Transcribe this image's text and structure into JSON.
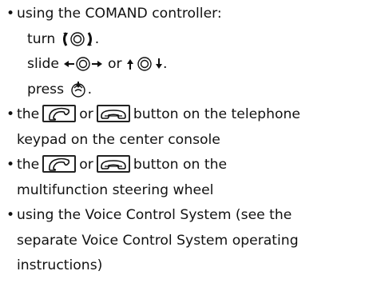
{
  "items": [
    {
      "intro": "using the COMAND controller:",
      "sub": [
        {
          "before": "turn",
          "icon": "rotate-controller-icon",
          "after": "."
        },
        {
          "before": "slide",
          "icon1": "slide-left-right-icon",
          "mid": "or",
          "icon2": "slide-up-down-icon",
          "after": "."
        },
        {
          "before": "press",
          "icon": "press-controller-icon",
          "after": "."
        }
      ]
    },
    {
      "before": "the",
      "key1": "phone-pickup-icon",
      "or": "or",
      "key2": "phone-hangup-icon",
      "line1_after": "button on the telephone",
      "line2": "keypad on the center console"
    },
    {
      "before": "the",
      "key1": "phone-pickup-icon",
      "or": "or",
      "key2": "phone-hangup-icon",
      "line1_after": "button on the",
      "line2": "multifunction steering wheel"
    },
    {
      "lines": [
        "using the Voice Control System (see the",
        "separate Voice Control System operating",
        "instructions)"
      ]
    }
  ]
}
